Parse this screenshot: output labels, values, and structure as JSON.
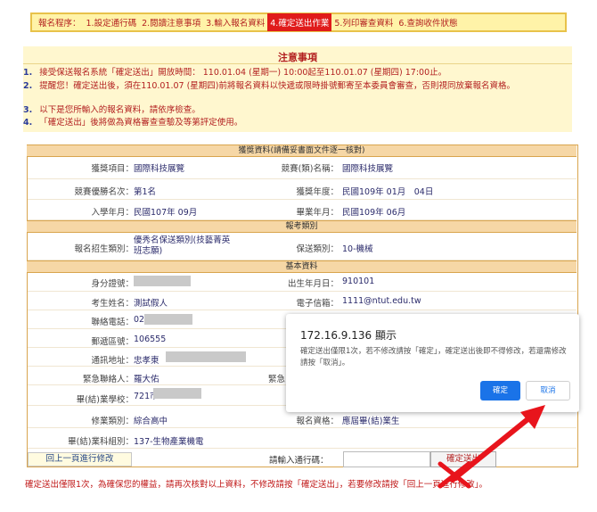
{
  "steps": [
    {
      "label": "報名程序：",
      "active": false
    },
    {
      "label": "1.設定通行碼",
      "active": false
    },
    {
      "label": "2.閱讀注意事項",
      "active": false
    },
    {
      "label": "3.輸入報名資料",
      "active": false
    },
    {
      "label": "4.確定送出作業",
      "active": true
    },
    {
      "label": "5.列印審查資料",
      "active": false
    },
    {
      "label": "6.查詢收件狀態",
      "active": false
    }
  ],
  "notice": {
    "title": "注意事項",
    "items": [
      {
        "num": "1.",
        "text": "接受保送報名系統「確定送出」開放時間： 110.01.04 (星期一) 10:00起至110.01.07 (星期四) 17:00止。"
      },
      {
        "num": "2.",
        "text": "提醒您！確定送出後，須在110.01.07 (星期四)前將報名資料以快遞或限時掛號郵寄至本委員會審查，否則視同放棄報名資格。"
      },
      {
        "num": "3.",
        "text": "以下是您所輸入的報名資料，請依序檢查。"
      },
      {
        "num": "4.",
        "text": "「確定送出」後將做為資格審查查驗及等第評定使用。"
      }
    ]
  },
  "form": {
    "section_award": "獲獎資料(請備妥書面文件逐一核對)",
    "award_item_label": "獲獎項目：",
    "award_item_value": "國際科技展覽",
    "competition_label": "競賽(類)名稱：",
    "competition_value": "國際科技展覽",
    "rank_label": "競賽優勝名次：",
    "rank_value": "第1名",
    "award_year_label": "獲獎年度：",
    "award_year_value": "民國109年 01月　04日",
    "enroll_label": "入學年月：",
    "enroll_value": "民國107年 09月",
    "grad_label": "畢業年月：",
    "grad_value": "民國109年 06月",
    "section_category": "報考類別",
    "apply_cat_label": "報名招生類別：",
    "apply_cat_value": "優秀名保送類別(技藝菁英班志願)",
    "send_cat_label": "保送類別：",
    "send_cat_value": "10-機械",
    "section_basic": "基本資料",
    "id_label": "身分證號：",
    "birth_label": "出生年月日：",
    "birth_value": "910101",
    "name_label": "考生姓名：",
    "name_value": "測試假人",
    "email_label": "電子信箱：",
    "email_value": "1111@ntut.edu.tw",
    "phone_label": "聯絡電話：",
    "phone_value": "02",
    "zip_label": "郵遞區號：",
    "zip_value": "106555",
    "address_label": "通訊地址：",
    "address_value": "忠孝東",
    "contact_label": "緊急聯絡人：",
    "contact_value": "羅大佑",
    "contact2_label": "緊急",
    "school_label": "畢(結)業學校：",
    "school_value": "721市",
    "program_label": "修業類別：",
    "program_value": "綜合高中",
    "qual_label": "報名資格：",
    "qual_value": "應屆畢(結)業生",
    "major_label": "畢(結)業科組別：",
    "major_value": "137-生物產業機電",
    "back_button": "回上一頁進行修改",
    "code_label": "請輸入通行碼：",
    "code_value": "",
    "confirm_button": "確定送出"
  },
  "footer": "確定送出僅限1次，為確保您的權益，請再次核對以上資料，不修改請按「確定送出」，若要修改請按「回上一頁進行修改」。",
  "dialog": {
    "title": "172.16.9.136 顯示",
    "message": "確定送出僅限1次，若不修改請按「確定」，確定送出後即不得修改，若還需修改請按「取消」。",
    "ok": "確定",
    "cancel": "取消"
  },
  "colors": {
    "accent": "#e01b1b",
    "link_blue": "#1a73e8",
    "section_bg": "#f6d7a6"
  }
}
